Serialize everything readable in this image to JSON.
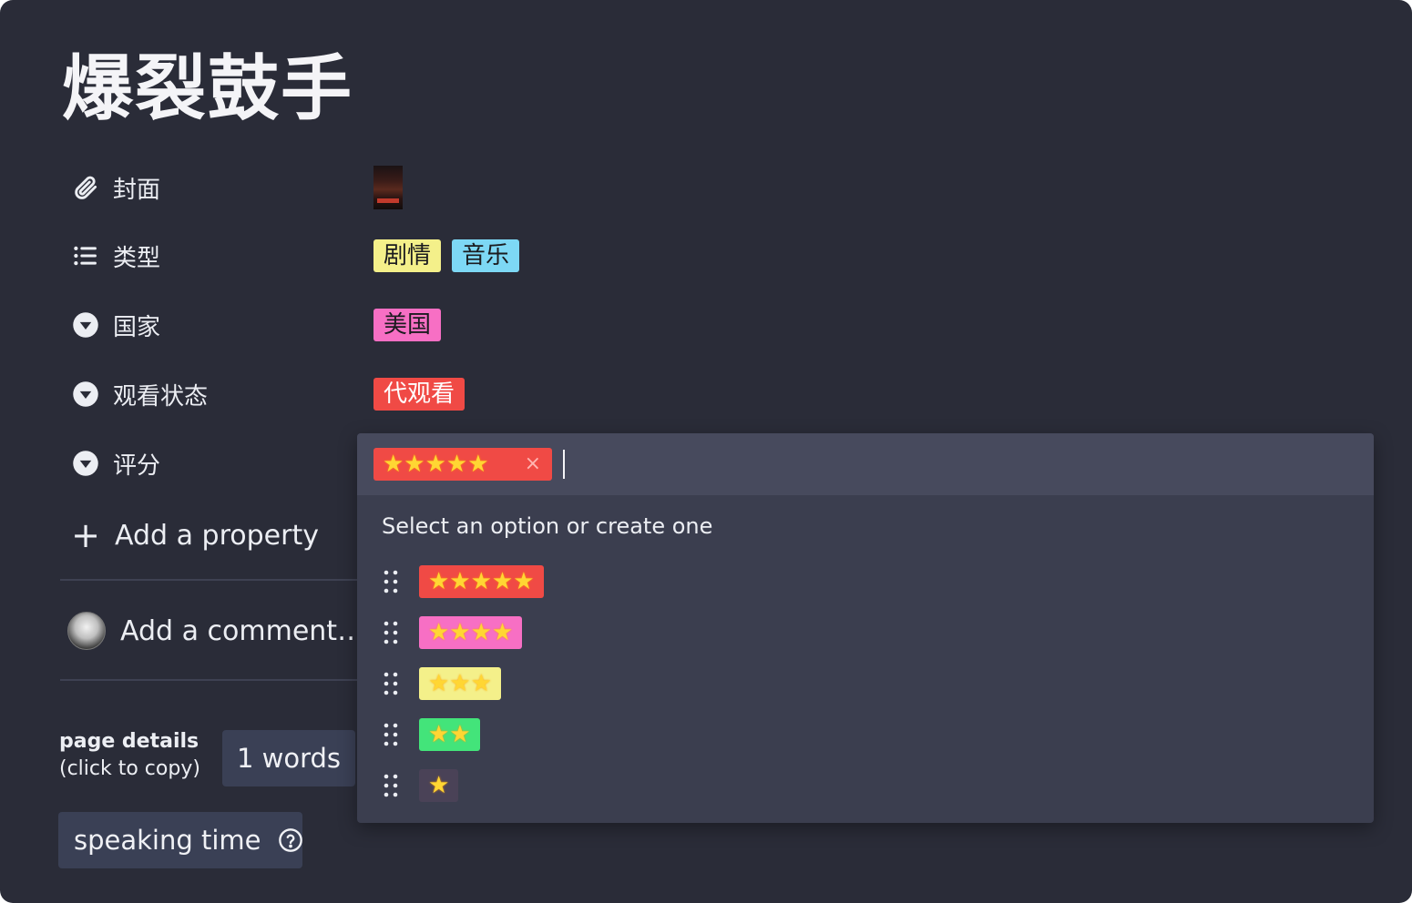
{
  "page": {
    "title": "爆裂鼓手"
  },
  "properties": [
    {
      "label": "封面",
      "icon": "paperclip-icon"
    },
    {
      "label": "类型",
      "icon": "list-icon"
    },
    {
      "label": "国家",
      "icon": "select-chevron-icon"
    },
    {
      "label": "观看状态",
      "icon": "select-chevron-icon"
    },
    {
      "label": "评分",
      "icon": "select-chevron-icon"
    }
  ],
  "values": {
    "genre_tags": [
      {
        "text": "剧情",
        "color": "#f4f08a"
      },
      {
        "text": "音乐",
        "color": "#7dd8f5"
      }
    ],
    "country_tag": {
      "text": "美国",
      "color": "#f76fc4"
    },
    "status_tag": {
      "text": "代观看",
      "color": "#f04a45"
    }
  },
  "add_property_label": "Add a property",
  "comment_placeholder": "Add a comment…",
  "page_details": {
    "title": "page details",
    "subtitle": "(click to copy)",
    "words": "1 words",
    "speaking_time": "speaking time"
  },
  "rating_dropdown": {
    "selected": {
      "stars": "★★★★★",
      "color": "#f04a45",
      "remove": "×"
    },
    "hint": "Select an option or create one",
    "options": [
      {
        "stars": "★★★★★",
        "color": "#f04a45"
      },
      {
        "stars": "★★★★",
        "color": "#f76fc4"
      },
      {
        "stars": "★★★",
        "color": "#f4f08a"
      },
      {
        "stars": "★★",
        "color": "#43e47a"
      },
      {
        "stars": "★",
        "color": "#4a4257"
      }
    ]
  }
}
